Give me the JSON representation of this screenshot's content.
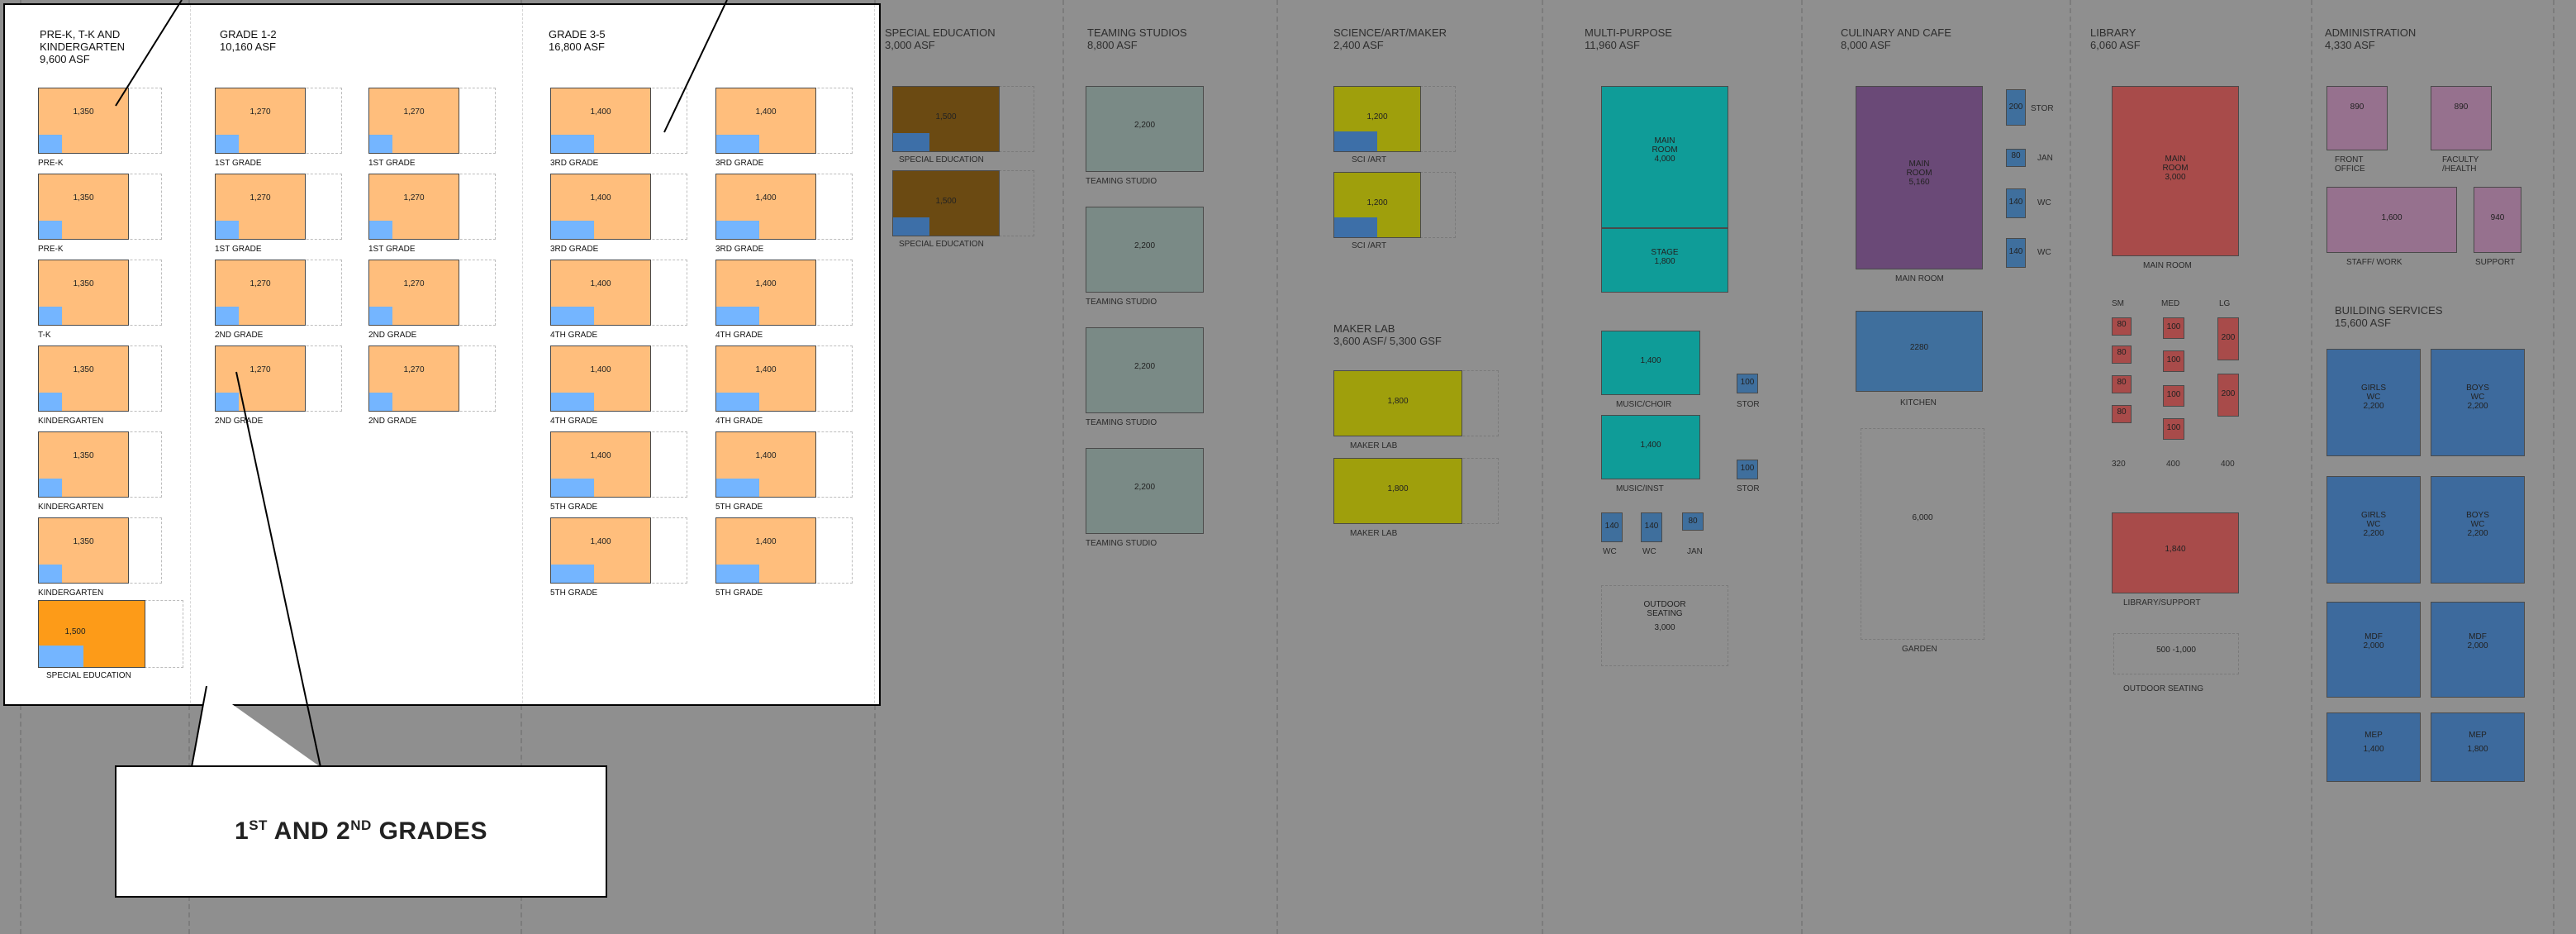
{
  "callout": {
    "text_a": "1",
    "sup_a": "ST",
    "text_b": " AND 2",
    "sup_b": "ND",
    "text_c": " GRADES"
  },
  "colors": {
    "classroom": "#ffbe7c",
    "sped_bright": "#fd9b18",
    "sped_dim": "#6b4a12",
    "window": "#74b5ff",
    "window_dim": "#3d6fa8",
    "teaming": "#7a8a86",
    "sci": "#9f9f0c",
    "teal": "#0f9c98",
    "purple": "#6a4977",
    "kitchen": "#3f6f9d",
    "library": "#a84b4a",
    "admin": "#96718e",
    "services": "#3d6a9d",
    "bg_dim": "#8f8f8f"
  },
  "spot": {
    "col1": {
      "t1": "PRE-K, T-K AND",
      "t2": "KINDERGARTEN",
      "t3": "9,600 ASF"
    },
    "col2": {
      "t1": "GRADE 1-2",
      "t2": "10,160 ASF"
    },
    "col3": {
      "t1": "GRADE 3-5",
      "t2": "16,800 ASF"
    },
    "c1_rooms": [
      {
        "v": "1,350",
        "cap": "PRE-K"
      },
      {
        "v": "1,350",
        "cap": "PRE-K"
      },
      {
        "v": "1,350",
        "cap": "T-K"
      },
      {
        "v": "1,350",
        "cap": "KINDERGARTEN"
      },
      {
        "v": "1,350",
        "cap": "KINDERGARTEN"
      },
      {
        "v": "1,350",
        "cap": "KINDERGARTEN"
      }
    ],
    "c1_sped": {
      "v": "1,500",
      "cap": "SPECIAL EDUCATION"
    },
    "c2a": [
      {
        "v": "1,270",
        "cap": "1ST GRADE"
      },
      {
        "v": "1,270",
        "cap": "1ST GRADE"
      },
      {
        "v": "1,270",
        "cap": "2ND GRADE"
      },
      {
        "v": "1,270",
        "cap": "2ND GRADE"
      }
    ],
    "c2b": [
      {
        "v": "1,270",
        "cap": "1ST GRADE"
      },
      {
        "v": "1,270",
        "cap": "1ST GRADE"
      },
      {
        "v": "1,270",
        "cap": "2ND GRADE"
      },
      {
        "v": "1,270",
        "cap": "2ND GRADE"
      }
    ],
    "c3a": [
      {
        "v": "1,400",
        "cap": "3RD GRADE"
      },
      {
        "v": "1,400",
        "cap": "3RD GRADE"
      },
      {
        "v": "1,400",
        "cap": "4TH GRADE"
      },
      {
        "v": "1,400",
        "cap": "4TH GRADE"
      },
      {
        "v": "1,400",
        "cap": "5TH GRADE"
      },
      {
        "v": "1,400",
        "cap": "5TH GRADE"
      }
    ],
    "c3b": [
      {
        "v": "1,400",
        "cap": "3RD GRADE"
      },
      {
        "v": "1,400",
        "cap": "3RD GRADE"
      },
      {
        "v": "1,400",
        "cap": "4TH GRADE"
      },
      {
        "v": "1,400",
        "cap": "4TH GRADE"
      },
      {
        "v": "1,400",
        "cap": "5TH GRADE"
      },
      {
        "v": "1,400",
        "cap": "5TH GRADE"
      }
    ]
  },
  "sped": {
    "t1": "SPECIAL EDUCATION",
    "t2": "3,000 ASF",
    "rooms": [
      {
        "v": "1,500",
        "cap": "SPECIAL EDUCATION"
      },
      {
        "v": "1,500",
        "cap": "SPECIAL EDUCATION"
      }
    ]
  },
  "teaming": {
    "t1": "TEAMING STUDIOS",
    "t2": "8,800 ASF",
    "rooms": [
      {
        "v": "2,200",
        "cap": "TEAMING STUDIO"
      },
      {
        "v": "2,200",
        "cap": "TEAMING STUDIO"
      },
      {
        "v": "2,200",
        "cap": "TEAMING STUDIO"
      },
      {
        "v": "2,200",
        "cap": "TEAMING STUDIO"
      }
    ]
  },
  "science": {
    "t1": "SCIENCE/ART/MAKER",
    "t2": "2,400 ASF",
    "rooms": [
      {
        "v": "1,200",
        "cap": "SCI /ART"
      },
      {
        "v": "1,200",
        "cap": "SCI /ART"
      }
    ],
    "maker_t1": "MAKER LAB",
    "maker_t2": "3,600 ASF/ 5,300 GSF",
    "maker": [
      {
        "v": "1,800",
        "cap": "MAKER LAB"
      },
      {
        "v": "1,800",
        "cap": "MAKER LAB"
      }
    ]
  },
  "multi": {
    "t1": "MULTI-PURPOSE",
    "t2": "11,960 ASF",
    "main_l1": "MAIN",
    "main_l2": "ROOM",
    "main_v": "4,000",
    "stage_l": "STAGE",
    "stage_v": "1,800",
    "choir_v": "1,400",
    "choir_cap": "MUSIC/CHOIR",
    "stor1_v": "100",
    "stor1_cap": "STOR",
    "inst_v": "1,400",
    "inst_cap": "MUSIC/INST",
    "stor2_v": "100",
    "stor2_cap": "STOR",
    "small": [
      {
        "v": "140",
        "cap": "WC"
      },
      {
        "v": "140",
        "cap": "WC"
      },
      {
        "v": "80",
        "cap": "JAN"
      }
    ],
    "outdoor_l1": "OUTDOOR",
    "outdoor_l2": "SEATING",
    "outdoor_v": "3,000"
  },
  "culinary": {
    "t1": "CULINARY AND CAFE",
    "t2": "8,000 ASF",
    "main_l1": "MAIN",
    "main_l2": "ROOM",
    "main_v": "5,160",
    "main_cap": "MAIN ROOM",
    "side": [
      {
        "v": "200",
        "cap": "STOR"
      },
      {
        "v": "80",
        "cap": "JAN"
      },
      {
        "v": "140",
        "cap": "WC"
      },
      {
        "v": "140",
        "cap": "WC"
      }
    ],
    "kitchen_v": "2280",
    "kitchen_cap": "KITCHEN",
    "garden_v": "6,000",
    "garden_cap": "GARDEN"
  },
  "library": {
    "t1": "LIBRARY",
    "t2": "6,060 ASF",
    "main_l1": "MAIN",
    "main_l2": "ROOM",
    "main_v": "3,000",
    "main_cap": "MAIN ROOM",
    "h_sm": "SM",
    "h_med": "MED",
    "h_lg": "LG",
    "sm": [
      "80",
      "80",
      "80",
      "80"
    ],
    "med": [
      "100",
      "100",
      "100",
      "100"
    ],
    "lg": [
      "200",
      "200"
    ],
    "f_sm": "320",
    "f_med": "400",
    "f_lg": "400",
    "support_v": "1,840",
    "support_cap": "LIBRARY/SUPPORT",
    "outdoor_v": "500 -1,000",
    "outdoor_cap": "OUTDOOR SEATING"
  },
  "admin": {
    "t1": "ADMINISTRATION",
    "t2": "4,330 ASF",
    "front_v": "890",
    "front_cap1": "FRONT",
    "front_cap2": "OFFICE",
    "fac_v": "890",
    "fac_cap1": "FACULTY",
    "fac_cap2": "/HEALTH",
    "staff_v": "1,600",
    "staff_cap": "STAFF/ WORK",
    "sup_v": "940",
    "sup_cap": "SUPPORT",
    "bs_t1": "BUILDING SERVICES",
    "bs_t2": "15,600 ASF",
    "bs": [
      {
        "l1": "GIRLS",
        "l2": "WC",
        "v": "2,200"
      },
      {
        "l1": "BOYS",
        "l2": "WC",
        "v": "2,200"
      },
      {
        "l1": "GIRLS",
        "l2": "WC",
        "v": "2,200"
      },
      {
        "l1": "BOYS",
        "l2": "WC",
        "v": "2,200"
      },
      {
        "l1": "MDF",
        "l2": "",
        "v": "2,000"
      },
      {
        "l1": "MDF",
        "l2": "",
        "v": "2,000"
      },
      {
        "l1": "MEP",
        "l2": "",
        "v": "1,400"
      },
      {
        "l1": "MEP",
        "l2": "",
        "v": "1,800"
      }
    ]
  }
}
